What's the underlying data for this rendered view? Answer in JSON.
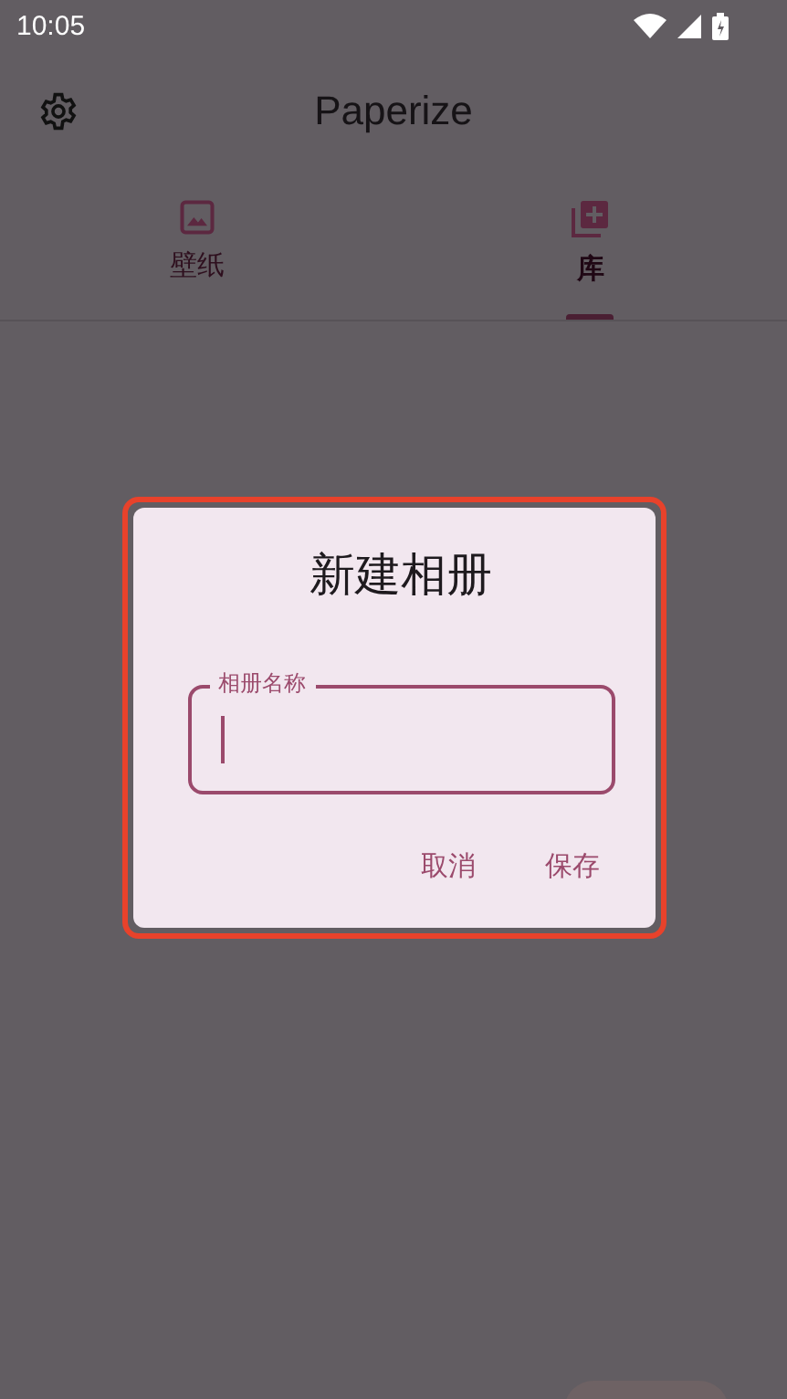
{
  "status_bar": {
    "time": "10:05"
  },
  "app_bar": {
    "title": "Paperize"
  },
  "tabs": [
    {
      "label": "壁纸",
      "kind": "image",
      "selected": false
    },
    {
      "label": "库",
      "kind": "library",
      "selected": true
    }
  ],
  "dialog": {
    "title": "新建相册",
    "field": {
      "label": "相册名称",
      "focused": true
    },
    "buttons": [
      "取消",
      "保存"
    ],
    "highlighted": true
  }
}
